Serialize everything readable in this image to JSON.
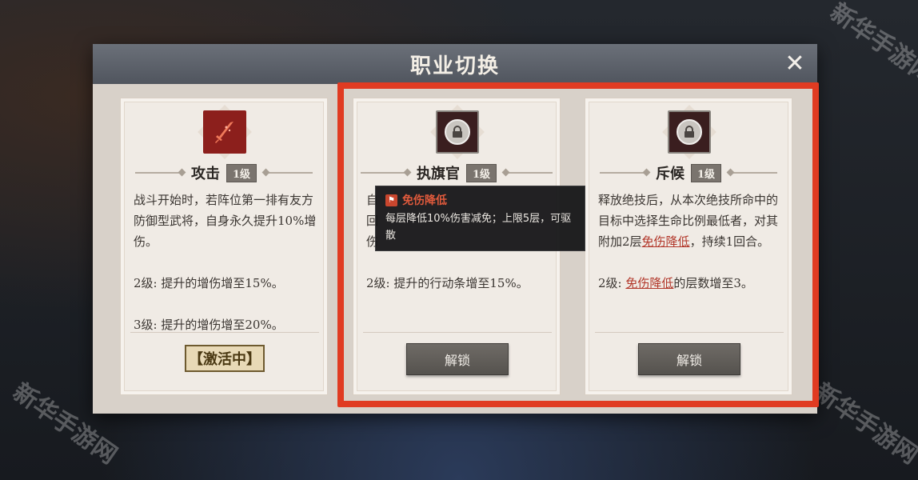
{
  "dialog": {
    "title": "职业切换",
    "close_label": "✕"
  },
  "cards": [
    {
      "name": "攻击",
      "level": "1级",
      "icon": "sword-icon",
      "desc1": "战斗开始时，若阵位第一排有友方防御型武将，自身永久提升10%增伤。",
      "desc2": "2级: 提升的增伤增至15%。",
      "desc3": "3级: 提升的增伤增至20%。",
      "status": "【激活中】"
    },
    {
      "name": "执旗官",
      "level": "1级",
      "icon": "lock-icon",
      "desc1_a": "自",
      "desc1_b": "回",
      "desc1_c": "伤",
      "desc2": "2级: 提升的行动条增至15%。",
      "button": "解锁"
    },
    {
      "name": "斥候",
      "level": "1级",
      "icon": "lock-icon",
      "desc1_pre": "释放绝技后，从本次绝技所命中的目标中选择生命比例最低者，对其附加2层",
      "desc1_kw": "免伤降低",
      "desc1_post": "，持续1回合。",
      "desc2_pre": "2级: ",
      "desc2_kw": "免伤降低",
      "desc2_post": "的层数增至3。",
      "button": "解锁"
    }
  ],
  "tooltip": {
    "title": "免伤降低",
    "text": "每层降低10%伤害减免；上限5层，可驱散"
  },
  "watermark": "新华手游网",
  "colors": {
    "highlight": "#e03b22",
    "keyword": "#b2372a"
  }
}
